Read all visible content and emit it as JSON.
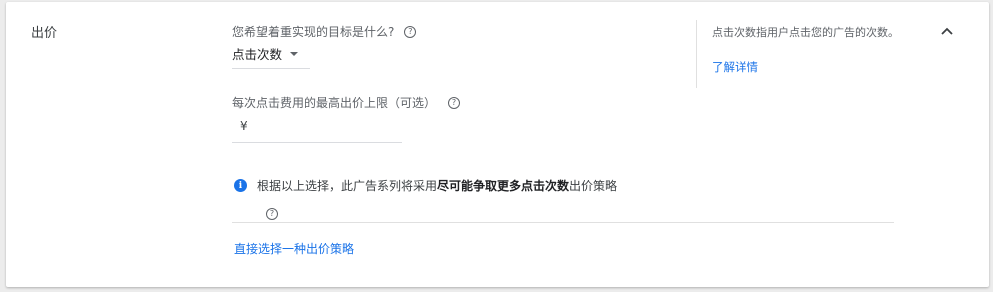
{
  "section": {
    "title": "出价"
  },
  "goal": {
    "question": "您希望着重实现的目标是什么?",
    "help_glyph": "?",
    "selected": "点击次数"
  },
  "max_cpc": {
    "label": "每次点击费用的最高出价上限（可选）",
    "help_glyph": "?",
    "currency": "¥",
    "value": ""
  },
  "notice": {
    "prefix": "根据以上选择，此广告系列将采用",
    "bold": "尽可能争取更多点击次数",
    "suffix": "出价策略",
    "info_glyph": "i",
    "help_glyph": "?"
  },
  "strategy_link": "直接选择一种出价策略",
  "side": {
    "description": "点击次数指用户点击您的广告的次数。",
    "learn_more": "了解详情"
  },
  "colors": {
    "accent": "#1a73e8",
    "text": "#202124",
    "muted": "#5f6368"
  }
}
